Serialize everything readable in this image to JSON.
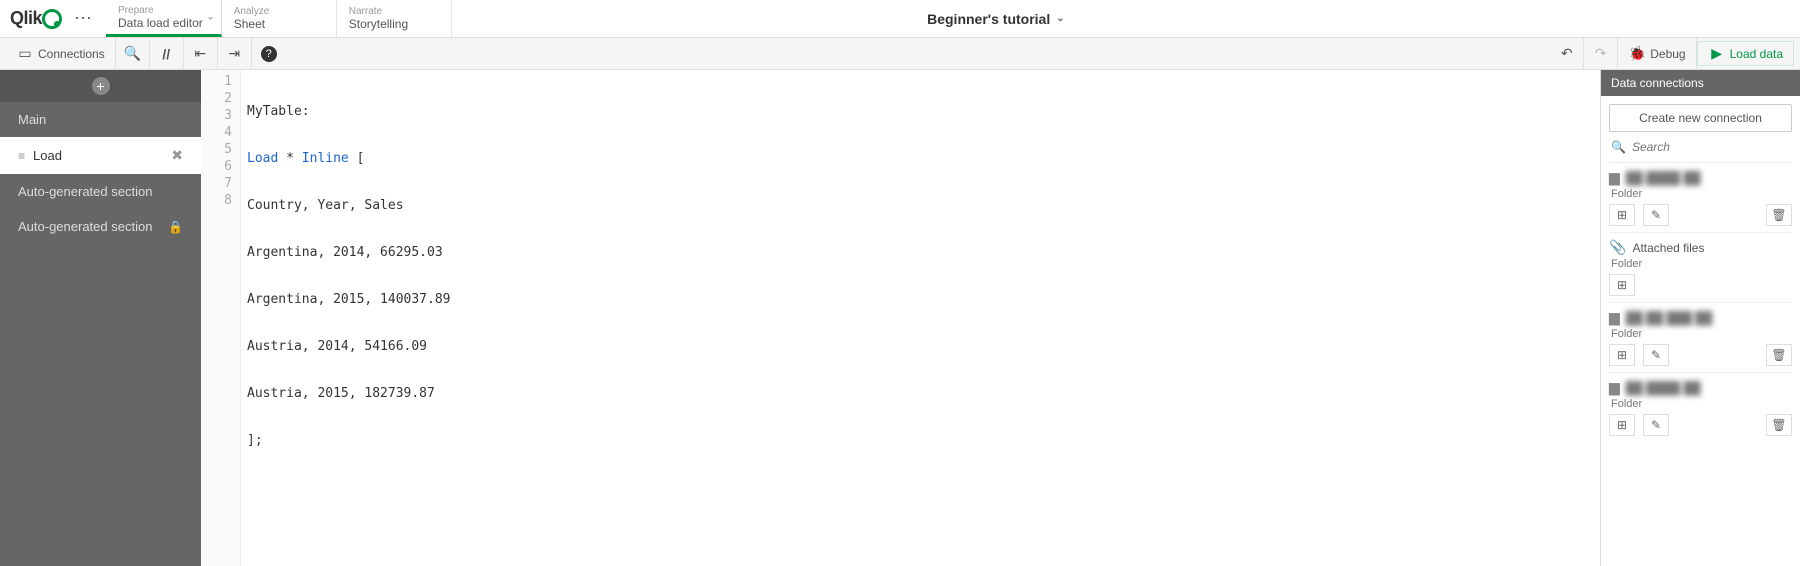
{
  "header": {
    "logo_text": "Qlik",
    "app_title": "Beginner's tutorial",
    "tabs": [
      {
        "small": "Prepare",
        "main": "Data load editor",
        "active": true,
        "has_chevron": true
      },
      {
        "small": "Analyze",
        "main": "Sheet",
        "active": false
      },
      {
        "small": "Narrate",
        "main": "Storytelling",
        "active": false
      }
    ]
  },
  "toolbar": {
    "connections_label": "Connections",
    "debug_label": "Debug",
    "load_label": "Load data"
  },
  "sections": {
    "items": [
      {
        "label": "Main",
        "active": false
      },
      {
        "label": "Load",
        "active": true,
        "closable": true
      },
      {
        "label": "Auto-generated section",
        "active": false
      },
      {
        "label": "Auto-generated section",
        "active": false,
        "locked": true
      }
    ]
  },
  "editor": {
    "lines": [
      {
        "n": "1",
        "plain": "MyTable:"
      },
      {
        "n": "2",
        "kw1": "Load",
        "mid": " * ",
        "kw2": "Inline",
        "rest": " ["
      },
      {
        "n": "3",
        "plain": "Country, Year, Sales"
      },
      {
        "n": "4",
        "plain": "Argentina, 2014, 66295.03"
      },
      {
        "n": "5",
        "plain": "Argentina, 2015, 140037.89"
      },
      {
        "n": "6",
        "plain": "Austria, 2014, 54166.09"
      },
      {
        "n": "7",
        "plain": "Austria, 2015, 182739.87"
      },
      {
        "n": "8",
        "plain": "];"
      }
    ]
  },
  "right": {
    "title": "Data connections",
    "new_btn": "Create new connection",
    "search_placeholder": "Search",
    "connections": [
      {
        "name": "██ ████ ██",
        "type": "Folder",
        "edit": true,
        "del": true
      },
      {
        "name": "Attached files",
        "type": "Folder",
        "attach_icon": true
      },
      {
        "name": "██ ██ ███ ██",
        "type": "Folder",
        "edit": true,
        "del": true
      },
      {
        "name": "██ ████ ██",
        "type": "Folder",
        "edit": true,
        "del": true
      }
    ]
  }
}
